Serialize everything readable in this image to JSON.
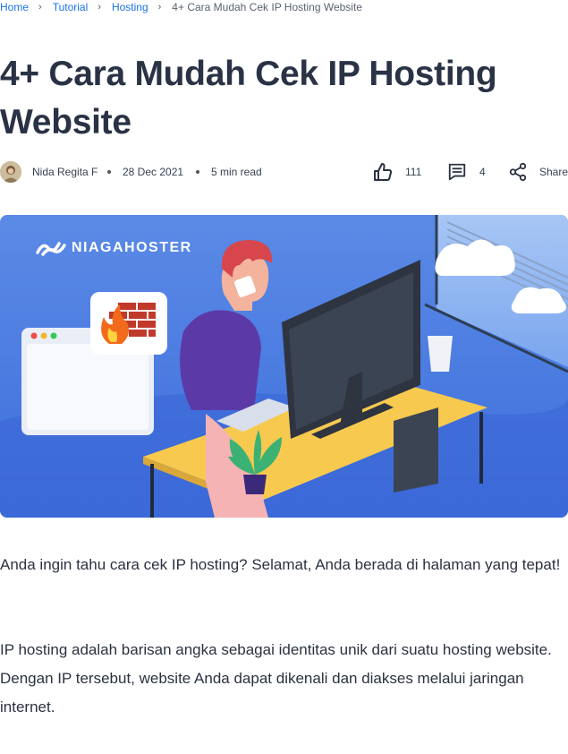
{
  "breadcrumb": {
    "home": "Home",
    "tutorial": "Tutorial",
    "hosting": "Hosting",
    "current": "4+ Cara Mudah Cek IP Hosting Website",
    "separator": "›"
  },
  "article": {
    "title": "4+ Cara Mudah Cek IP Hosting Website",
    "author": "Nida Regita F",
    "date": "28 Dec 2021",
    "read_time": "5 min read",
    "likes": "111",
    "comments": "4",
    "share_label": "Share",
    "hero_brand": "NIAGAHOSTER",
    "paragraphs": [
      "Anda ingin tahu cara cek IP hosting? Selamat, Anda berada di halaman yang tepat!",
      "IP hosting adalah barisan angka sebagai identitas unik dari suatu hosting website. Dengan IP tersebut, website Anda dapat dikenali dan diakses melalui jaringan internet."
    ]
  },
  "icons": {
    "like": "thumbs-up-icon",
    "comment": "comment-icon",
    "share": "share-icon",
    "separator": "chevron-right-icon"
  },
  "colors": {
    "link": "#1a73e8",
    "title": "#2a3245",
    "hero_bg": "#4b7ce0",
    "desk": "#f7c94f"
  }
}
